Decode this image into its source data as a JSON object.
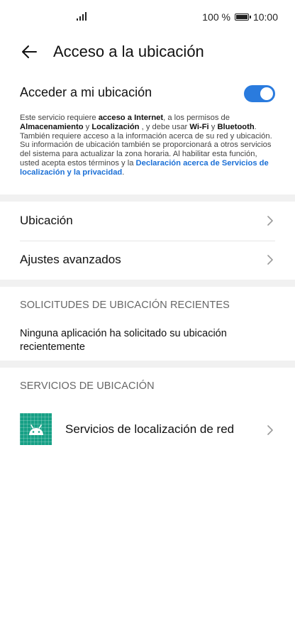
{
  "status_bar": {
    "battery_percent": "100 %",
    "time": "10:00"
  },
  "header": {
    "title": "Acceso a la ubicación"
  },
  "location_access": {
    "label": "Acceder a mi ubicación",
    "enabled": true,
    "desc_1": "Este servicio requiere ",
    "desc_b1": "acceso a Internet",
    "desc_2": ", a los permisos de ",
    "desc_b2": "Almacenamiento",
    "desc_3": " y ",
    "desc_b3": "Localización",
    "desc_4": " , y debe usar ",
    "desc_b4": "Wi-Fi",
    "desc_5": " y ",
    "desc_b5": "Bluetooth",
    "desc_6": ". También requiere acceso a la información acerca de su red y ubicación. Su información de ubicación también se proporcionará a otros servicios del sistema para actualizar la zona horaria. Al habilitar esta función, usted acepta estos términos y la ",
    "desc_link": "Declaración acerca de Servicios de localización y la privacidad",
    "desc_7": "."
  },
  "menu": {
    "items": [
      {
        "label": "Ubicación"
      },
      {
        "label": "Ajustes avanzados"
      }
    ]
  },
  "recent_requests": {
    "header": "SOLICITUDES DE UBICACIÓN RECIENTES",
    "empty_message": "Ninguna aplicación ha solicitado su ubicación recientemente"
  },
  "location_services": {
    "header": "SERVICIOS DE UBICACIÓN",
    "items": [
      {
        "label": "Servicios de localización de red",
        "icon": "android-icon"
      }
    ]
  },
  "colors": {
    "accent": "#2a7bde",
    "link": "#1a6fd6",
    "app_icon_bg": "#16a085"
  }
}
